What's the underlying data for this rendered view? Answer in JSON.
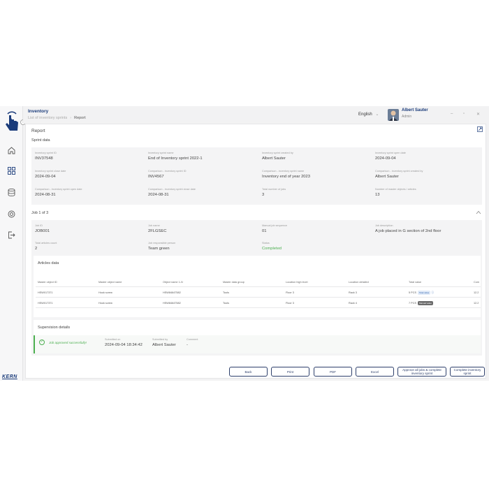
{
  "header": {
    "title": "Inventory",
    "breadcrumb": [
      "List of inventory sprints",
      "Report"
    ],
    "language": "English",
    "user": {
      "name": "Albert Sauter",
      "role": "Admin"
    }
  },
  "brand": {
    "logo_text": "KERN",
    "accent": "#1a3b7a",
    "success": "#4caf50"
  },
  "report": {
    "title": "Report",
    "sprint_section": "Sprint data",
    "sprint_fields": [
      {
        "label": "Inventory sprint ID",
        "value": "INV37548"
      },
      {
        "label": "Inventory sprint name",
        "value": "End of Inventory sprint 2022-1"
      },
      {
        "label": "Inventory sprint created by",
        "value": "Albert Sauter"
      },
      {
        "label": "Inventory sprint open date",
        "value": "2024-09-04"
      },
      {
        "label": "Inventory sprint close date",
        "value": "2024-09-04"
      },
      {
        "label": "Comparison - inventory sprint ID",
        "value": "INV4567"
      },
      {
        "label": "Comparison - inventory sprint name",
        "value": "Inventory end of year 2023"
      },
      {
        "label": "Comparison - inventory sprint created by",
        "value": "Albert Sauter"
      },
      {
        "label": "Comparison - inventory sprint open date",
        "value": "2024-08-31"
      },
      {
        "label": "Comparison - inventory sprint close date",
        "value": "2024-08-31"
      },
      {
        "label": "Total number of jobs",
        "value": "3"
      },
      {
        "label": "Number of master objects / articles",
        "value": "13"
      }
    ],
    "job_section": "Job 1 of 3",
    "job_fields": [
      {
        "label": "Job ID",
        "value": "JOB001"
      },
      {
        "label": "Job name",
        "value": "2FLGSEC"
      },
      {
        "label": "Manual job sequence",
        "value": "01"
      },
      {
        "label": "Job description",
        "value": "A job placed in G section of 2nd floor"
      },
      {
        "label": "Total articles count",
        "value": "2"
      },
      {
        "label": "Job responsible person",
        "value": "Team green"
      },
      {
        "label": "Status",
        "value": "Completed"
      }
    ],
    "articles": {
      "title": "Articles data",
      "columns": [
        "Master object ID",
        "Master object name",
        "Object name 1-N",
        "Master data group",
        "Location high level",
        "Location detailed",
        "Total value",
        "Com"
      ],
      "rows": [
        [
          "HSW017371",
          "Hook screw",
          "HSW84647582",
          "Tools",
          "Floor 3",
          "Rack 3",
          "5 PCS",
          "12.2"
        ],
        [
          "HSW017371",
          "Hook screw",
          "HSW84647582",
          "Tools",
          "Floor 3",
          "Rack 4",
          "7 PCS",
          "12.2"
        ]
      ],
      "row_tags": [
        "Total value",
        "Manual value"
      ]
    },
    "supervision": {
      "title": "Supervision details",
      "message": "Job approved successfully!",
      "fields": [
        {
          "label": "Submitted on",
          "value": "2024-09-04 18:34:42"
        },
        {
          "label": "Submitted by",
          "value": "Albert Sauter"
        },
        {
          "label": "Comment",
          "value": "-"
        }
      ]
    }
  },
  "actions": {
    "back": "Back",
    "print": "Print",
    "pdf": "PDF",
    "excel": "Excel",
    "approve_all": "Approve all jobs & complete inventory sprint",
    "complete": "Complete inventory sprint"
  }
}
